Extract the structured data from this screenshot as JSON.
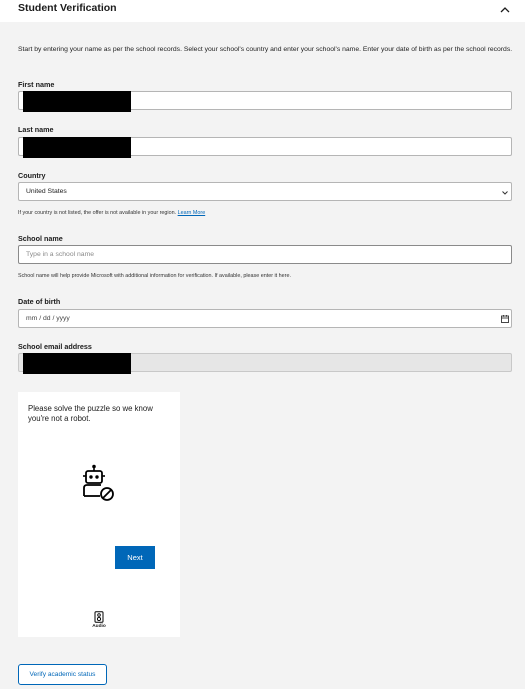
{
  "header": {
    "title": "Student Verification"
  },
  "intro": "Start by entering your name as per the school records. Select your school's country and enter your school's name. Enter your date of birth as per the school records.",
  "fields": {
    "first_name": {
      "label": "First name",
      "value": ""
    },
    "last_name": {
      "label": "Last name",
      "value": ""
    },
    "country": {
      "label": "Country",
      "selected": "United States",
      "helper": "If your country is not listed, the offer is not available in your region.",
      "helper_link": "Learn More"
    },
    "school_name": {
      "label": "School name",
      "placeholder": "Type in a school name",
      "helper": "School name will help provide Microsoft with additional information for verification. If available, please enter it here."
    },
    "date_of_birth": {
      "label": "Date of birth",
      "placeholder": "mm / dd / yyyy"
    },
    "school_email": {
      "label": "School email address",
      "value": ""
    }
  },
  "puzzle": {
    "prompt": "Please solve the puzzle so we know you're not a robot.",
    "next_label": "Next",
    "audio_label": "Audio"
  },
  "verify_button_label": "Verify academic status",
  "colors": {
    "accent": "#0067b8",
    "background": "#f3f3f3",
    "redaction": "#000000"
  }
}
